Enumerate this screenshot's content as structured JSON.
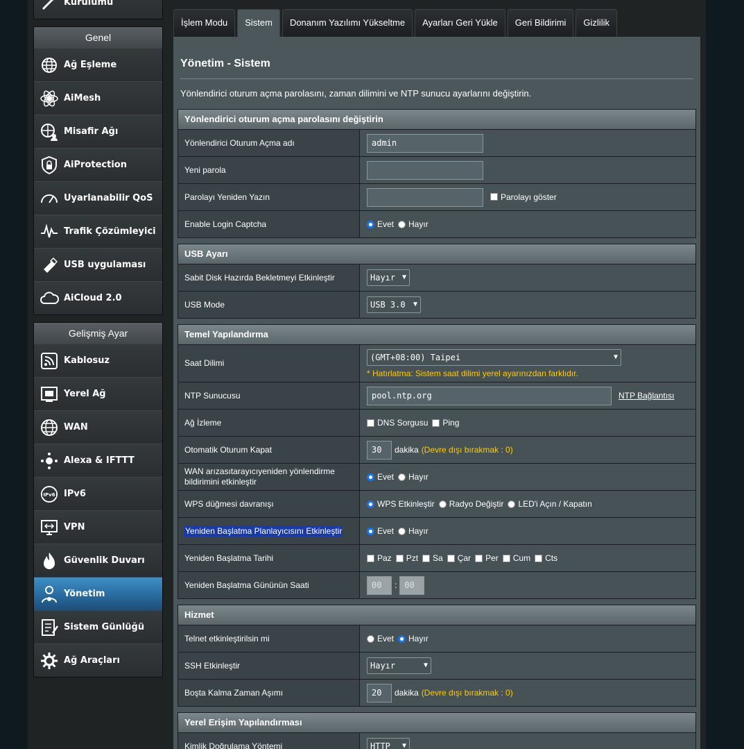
{
  "sidebar": {
    "top_item": "Kurulumu",
    "general_head": "Genel",
    "general_items": [
      "Ağ Eşleme",
      "AiMesh",
      "Misafir Ağı",
      "AiProtection",
      "Uyarlanabilir QoS",
      "Trafik Çözümleyici",
      "USB uygulaması",
      "AiCloud 2.0"
    ],
    "advanced_head": "Gelişmiş Ayar",
    "advanced_items": [
      "Kablosuz",
      "Yerel Ağ",
      "WAN",
      "Alexa & IFTTT",
      "IPv6",
      "VPN",
      "Güvenlik Duvarı",
      "Yönetim",
      "Sistem Günlüğü",
      "Ağ Araçları"
    ]
  },
  "tabs": [
    "İşlem Modu",
    "Sistem",
    "Donanım Yazılımı Yükseltme",
    "Ayarları Geri Yükle",
    "Geri Bildirimi",
    "Gizlilik"
  ],
  "page": {
    "title": "Yönetim - Sistem",
    "desc": "Yönlendirici oturum açma parolasını, zaman dilimini ve NTP sunucu ayarlarını değiştirin."
  },
  "login": {
    "head": "Yönlendirici oturum açma parolasını değiştirin",
    "name_label": "Yönlendirici Oturum Açma adı",
    "name_value": "admin",
    "newpass_label": "Yeni parola",
    "retype_label": "Parolayı Yeniden Yazın",
    "show_pass": "Parolayı göster",
    "captcha_label": "Enable Login Captcha",
    "yes": "Evet",
    "no": "Hayır"
  },
  "usb": {
    "head": "USB Ayarı",
    "hdd_label": "Sabit Disk Hazırda Bekletmeyi Etkinleştir",
    "hdd_value": "Hayır",
    "mode_label": "USB Mode",
    "mode_value": "USB 3.0"
  },
  "basic": {
    "head": "Temel Yapılandırma",
    "tz_label": "Saat Dilimi",
    "tz_value": "(GMT+08:00) Taipei",
    "tz_hint": "* Hatırlatma: Sistem saat dilimi yerel ayarınızdan farklıdır.",
    "ntp_label": "NTP Sunucusu",
    "ntp_value": "pool.ntp.org",
    "ntp_link": "NTP Bağlantısı",
    "monitor_label": "Ağ İzleme",
    "dns": "DNS Sorgusu",
    "ping": "Ping",
    "logout_label": "Otomatik Oturum Kapat",
    "logout_value": "30",
    "minutes": "dakika",
    "disable_hint": "(Devre dışı bırakmak : 0)",
    "wan_label": "WAN arızasıtarayıcıyeniden yönlendirme bildirimini etkinleştir",
    "wps_label": "WPS düğmesi davranışı",
    "wps_opts": [
      "WPS Etkinleştir",
      "Radyo Değiştir",
      "LED'i Açın / Kapatın"
    ],
    "reboot_label": "Yeniden Başlatma Planlayıcısını Etkinleştir",
    "reboot_date_label": "Yeniden Başlatma Tarihi",
    "days": [
      "Paz",
      "Pzt",
      "Sa",
      "Çar",
      "Per",
      "Cum",
      "Cts"
    ],
    "reboot_time_label": "Yeniden Başlatma Gününün Saati",
    "hour": "00",
    "minute": "00",
    "colon": ":"
  },
  "service": {
    "head": "Hizmet",
    "telnet_label": "Telnet etkinleştirilsin mi",
    "ssh_label": "SSH Etkinleştir",
    "ssh_value": "Hayır",
    "idle_label": "Boşta Kalma Zaman Aşımı",
    "idle_value": "20"
  },
  "local": {
    "head": "Yerel Erişim Yapılandırması",
    "auth_label": "Kimlik Doğrulama Yöntemi",
    "auth_value": "HTTP"
  }
}
